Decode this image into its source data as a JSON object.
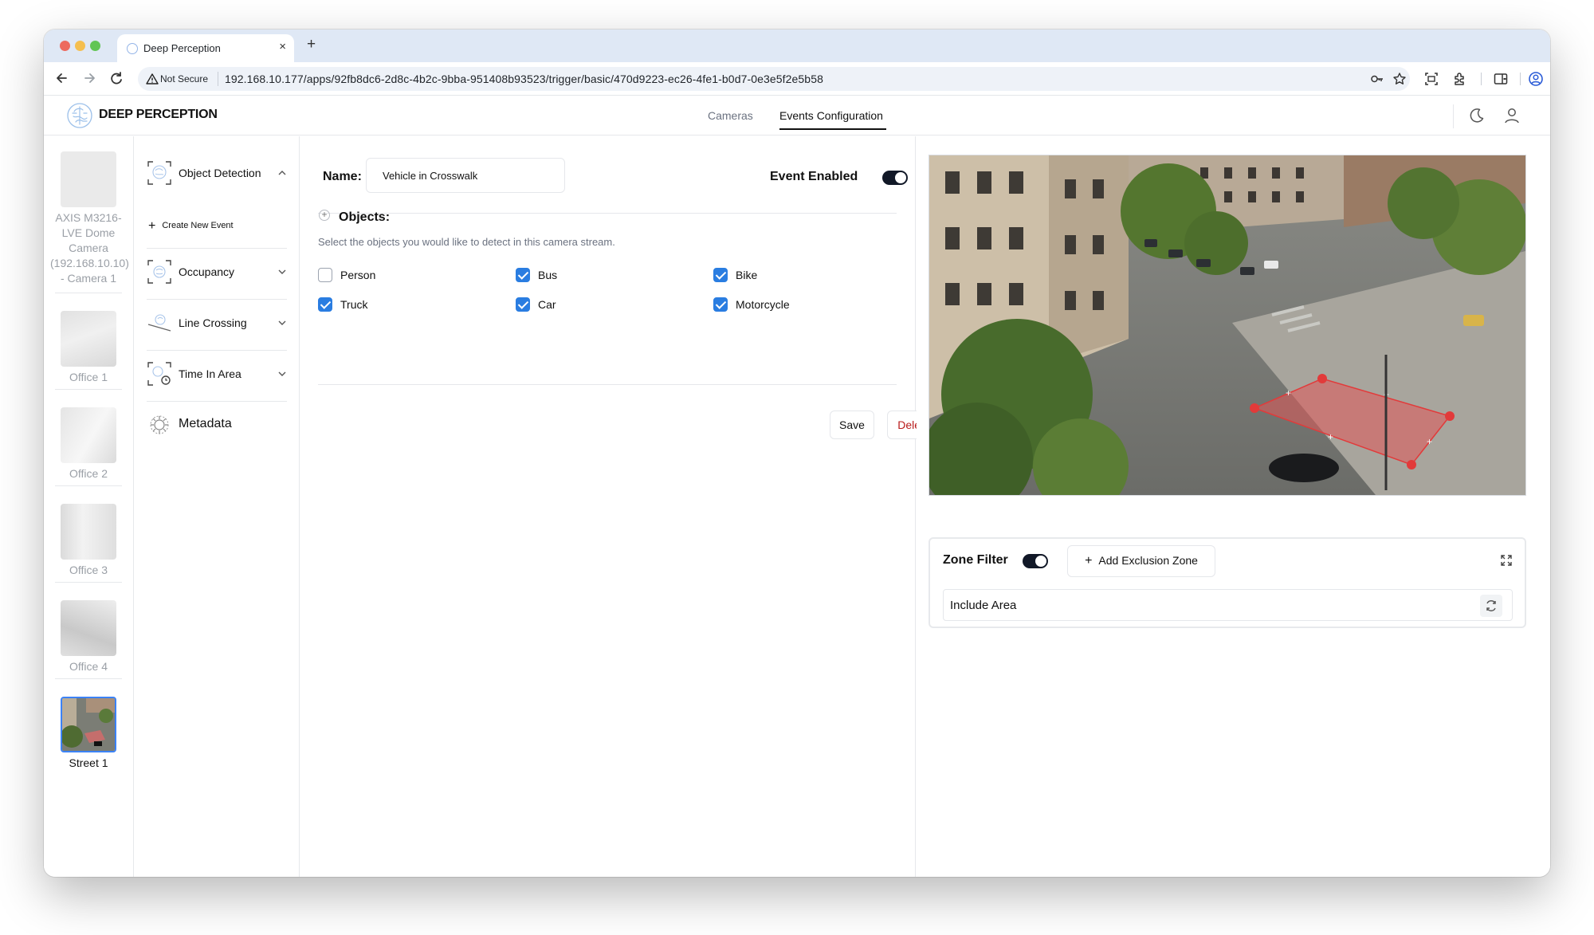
{
  "browser": {
    "tab_title": "Deep Perception",
    "security_label": "Not Secure",
    "url": "192.168.10.177/apps/92fb8dc6-2d8c-4b2c-9bba-951408b93523/trigger/basic/470d9223-ec26-4fe1-b0d7-0e3e5f2e5b58"
  },
  "app": {
    "brand": "DEEP PERCEPTION",
    "nav": [
      {
        "label": "Cameras"
      },
      {
        "label": "Events Configuration"
      }
    ]
  },
  "cameras": [
    {
      "label": "AXIS M3216-LVE Dome Camera (192.168.10.10) - Camera 1",
      "selected": false
    },
    {
      "label": "Office 1",
      "selected": false
    },
    {
      "label": "Office 2",
      "selected": false
    },
    {
      "label": "Office 3",
      "selected": false
    },
    {
      "label": "Office 4",
      "selected": false
    },
    {
      "label": "Street 1",
      "selected": true
    }
  ],
  "event_types": [
    {
      "label": "Object Detection",
      "icon": "object-detection-icon",
      "expanded": true
    },
    {
      "label": "Occupancy",
      "icon": "occupancy-icon",
      "expanded": false
    },
    {
      "label": "Line Crossing",
      "icon": "line-crossing-icon",
      "expanded": false
    },
    {
      "label": "Time In Area",
      "icon": "time-in-area-icon",
      "expanded": false
    },
    {
      "label": "Metadata",
      "icon": "metadata-icon",
      "expanded": false
    }
  ],
  "create_new_event": "Create New Event",
  "form": {
    "name_label": "Name:",
    "name_value": "Vehicle in Crosswalk",
    "enabled_label": "Event Enabled",
    "enabled": true,
    "objects_title": "Objects:",
    "objects_desc": "Select the objects you would like to detect in this camera stream.",
    "objects": [
      {
        "label": "Person",
        "checked": false
      },
      {
        "label": "Bus",
        "checked": true
      },
      {
        "label": "Bike",
        "checked": true
      },
      {
        "label": "Truck",
        "checked": true
      },
      {
        "label": "Car",
        "checked": true
      },
      {
        "label": "Motorcycle",
        "checked": true
      }
    ],
    "save_label": "Save",
    "delete_label": "Delete"
  },
  "zone": {
    "title": "Zone Filter",
    "enabled": true,
    "add_label": "Add Exclusion Zone",
    "include_label": "Include Area"
  },
  "colors": {
    "accent": "#2a7de1",
    "delete": "#b91c1c",
    "zone_fill": "#e05757",
    "zone_point": "#e23a3a"
  }
}
